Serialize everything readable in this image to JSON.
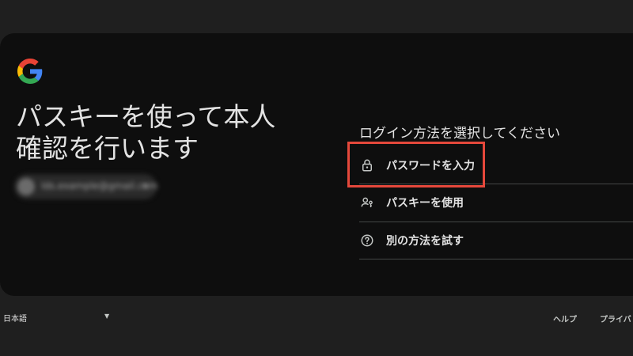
{
  "headline": "パスキーを使って本人\n確認を行います",
  "account": {
    "email": "lds.example@gmail.com"
  },
  "signin": {
    "section_title": "ログイン方法を選択してください",
    "options": [
      {
        "label": "パスワードを入力",
        "icon": "lock-icon"
      },
      {
        "label": "パスキーを使用",
        "icon": "passkey-person-icon"
      },
      {
        "label": "別の方法を試す",
        "icon": "help-circle-icon"
      }
    ]
  },
  "footer": {
    "language": "日本語",
    "help": "ヘルプ",
    "privacy": "プライバ"
  },
  "colors": {
    "background": "#1f1f1f",
    "card": "#0e0e0e",
    "highlight": "#e5483b",
    "google_blue": "#4285F4",
    "google_red": "#EA4335",
    "google_yellow": "#FBBC05",
    "google_green": "#34A853"
  }
}
